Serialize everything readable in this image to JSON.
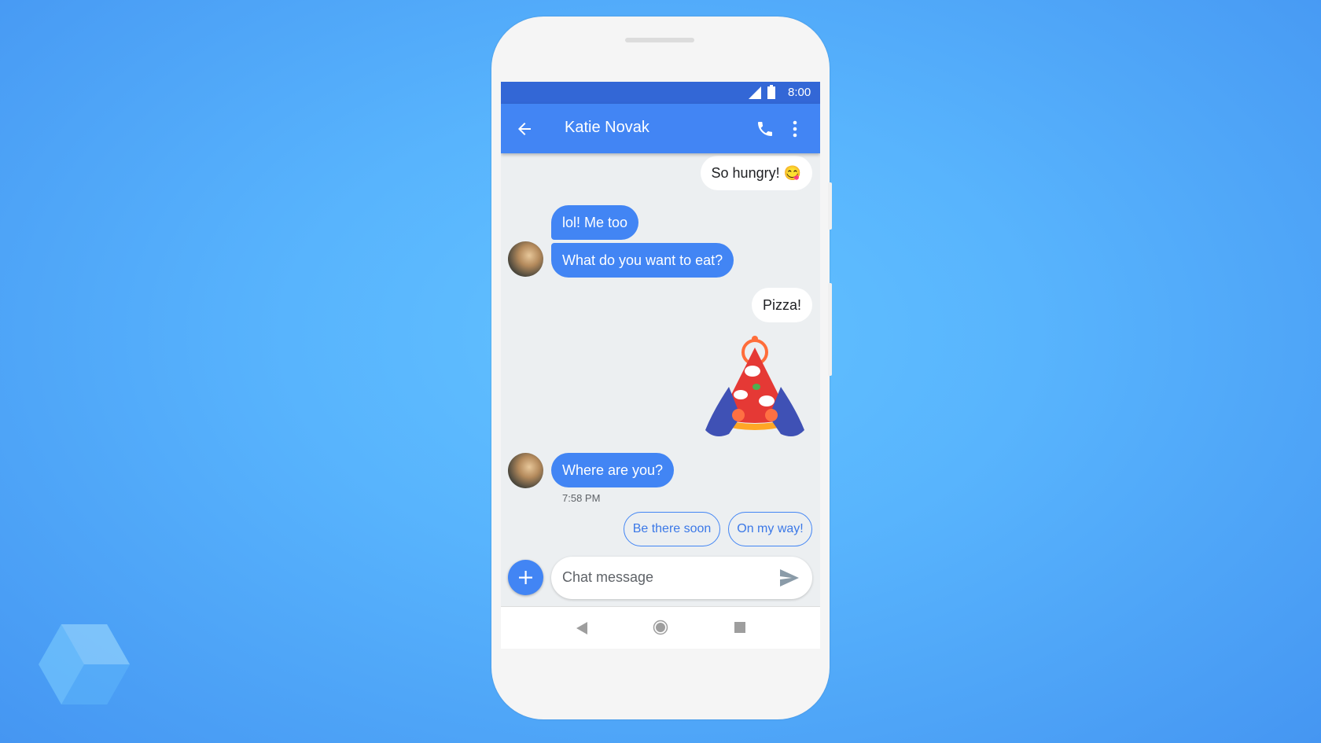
{
  "status_bar": {
    "time": "8:00",
    "icons": [
      "signal-icon",
      "battery-icon"
    ]
  },
  "app_bar": {
    "title": "Katie Novak",
    "icons": [
      "back-arrow-icon",
      "phone-icon",
      "more-vert-icon"
    ]
  },
  "messages": [
    {
      "sender": "me",
      "text": "So hungry! 😋"
    },
    {
      "sender": "them",
      "text": "lol! Me too"
    },
    {
      "sender": "them",
      "text": "What do you want to eat?"
    },
    {
      "sender": "me",
      "text": "Pizza!"
    },
    {
      "sender": "me",
      "type": "sticker",
      "sticker": "pizza-sticker"
    },
    {
      "sender": "them",
      "text": "Where are you?",
      "time": "7:58 PM"
    }
  ],
  "smart_replies": [
    "Be there soon",
    "On my way!"
  ],
  "composer": {
    "placeholder": "Chat message",
    "icons": [
      "add-icon",
      "send-icon"
    ]
  },
  "colors": {
    "primary": "#4285f4",
    "status_bar": "#3367d6",
    "chat_bg": "#eceff1"
  }
}
